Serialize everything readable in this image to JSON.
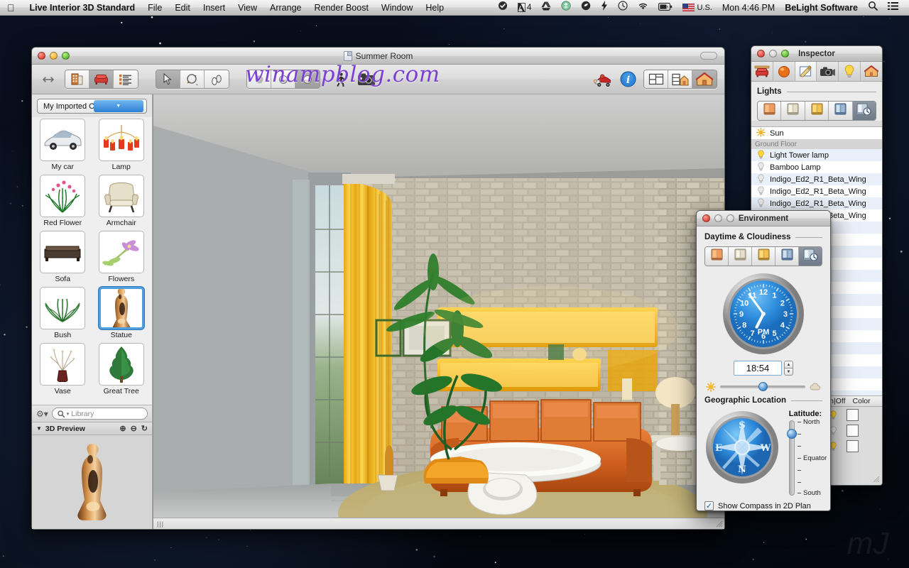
{
  "menubar": {
    "apple_icon": "apple-icon",
    "app_name": "Live Interior 3D Standard",
    "items": [
      "File",
      "Edit",
      "Insert",
      "View",
      "Arrange",
      "Render Boost",
      "Window",
      "Help"
    ],
    "status_icons": [
      "checkmark-circle-icon",
      "adobe-icon",
      "google-drive-icon",
      "dropbox-icon",
      "evernote-icon",
      "flash-icon",
      "time-machine-icon",
      "wifi-icon",
      "battery-icon"
    ],
    "adobe_badge": "4",
    "input_source": "U.S.",
    "clock": "Mon 4:46 PM",
    "user": "BeLight Software",
    "spotlight_icon": "search-icon",
    "notification_icon": "notification-center-icon"
  },
  "main_window": {
    "title": "Summer Room",
    "watermark": "winampblog.com",
    "toolbar": {
      "resize_icon": "resize-arrows-icon",
      "group_view": [
        {
          "name": "elevation-view-button",
          "icon": "building-icon",
          "active": false
        },
        {
          "name": "furniture-view-button",
          "icon": "armchair-icon",
          "active": true
        },
        {
          "name": "list-view-button",
          "icon": "list-icon",
          "active": false
        }
      ],
      "group_tools": [
        {
          "name": "select-tool-button",
          "icon": "arrow-cursor-icon",
          "active": true
        },
        {
          "name": "rotate-tool-button",
          "icon": "rotate-icon",
          "active": false
        },
        {
          "name": "move-tool-button",
          "icon": "footsteps-icon",
          "active": false
        }
      ],
      "group_render": [
        {
          "name": "flat-shading-button",
          "icon": "flat-sphere-icon",
          "active": false
        },
        {
          "name": "smooth-shading-button",
          "icon": "half-sphere-icon",
          "active": false
        },
        {
          "name": "realistic-shading-button",
          "icon": "shaded-sphere-icon",
          "active": true
        }
      ],
      "walk_button": {
        "name": "walkthrough-button",
        "icon": "walking-person-icon"
      },
      "camera_button": {
        "name": "camera-button",
        "icon": "camera-icon"
      },
      "truck_button": {
        "name": "render-boost-button",
        "icon": "red-truck-icon"
      },
      "info_button": {
        "name": "info-button",
        "icon": "info-circle-icon"
      },
      "group_layout": [
        {
          "name": "plan-view-button",
          "icon": "floorplan-icon",
          "active": false
        },
        {
          "name": "split-view-button",
          "icon": "split-house-icon",
          "active": false
        },
        {
          "name": "house-3d-view-button",
          "icon": "house-icon",
          "active": true
        }
      ]
    },
    "library": {
      "category": "My Imported Objects",
      "dropdown_icon": "chevron-down-icon",
      "objects": [
        {
          "label": "My car",
          "icon": "car-thumb",
          "selected": false
        },
        {
          "label": "Lamp",
          "icon": "chandelier-thumb",
          "selected": false
        },
        {
          "label": "Red Flower",
          "icon": "red-flower-thumb",
          "selected": false
        },
        {
          "label": "Armchair",
          "icon": "armchair-thumb",
          "selected": false
        },
        {
          "label": "Sofa",
          "icon": "sofa-thumb",
          "selected": false
        },
        {
          "label": "Flowers",
          "icon": "flowers-thumb",
          "selected": false
        },
        {
          "label": "Bush",
          "icon": "bush-thumb",
          "selected": false
        },
        {
          "label": "Statue",
          "icon": "statue-thumb",
          "selected": true
        },
        {
          "label": "Vase",
          "icon": "vase-thumb",
          "selected": false
        },
        {
          "label": "Great Tree",
          "icon": "tree-thumb",
          "selected": false
        }
      ],
      "gear_icon": "gear-icon",
      "search_icon": "search-icon",
      "search_placeholder": "Library",
      "search_value": "",
      "preview_title": "3D Preview",
      "preview_disclosure_icon": "triangle-down-icon",
      "preview_zoom_in_icon": "zoom-in-icon",
      "preview_zoom_out_icon": "zoom-out-icon",
      "preview_rotate_icon": "rotate-icon"
    },
    "viewport_grip_icon": "resize-grip-icon"
  },
  "inspector": {
    "title": "Inspector",
    "tabs": [
      {
        "name": "object-tab",
        "icon": "furniture-icon",
        "active": false
      },
      {
        "name": "material-tab",
        "icon": "orange-sphere-icon",
        "active": false
      },
      {
        "name": "edit-tab",
        "icon": "pencil-pad-icon",
        "active": true
      },
      {
        "name": "camera-tab",
        "icon": "camera-icon",
        "active": false
      },
      {
        "name": "light-tab",
        "icon": "lightbulb-icon",
        "active": false
      },
      {
        "name": "site-tab",
        "icon": "house-icon",
        "active": false
      }
    ],
    "group_title": "Lights",
    "light_modes": [
      {
        "name": "light-mode-sunset",
        "icon": "window-sunset-icon",
        "active": false
      },
      {
        "name": "light-mode-day",
        "icon": "window-day-icon",
        "active": false
      },
      {
        "name": "light-mode-warm",
        "icon": "window-warm-icon",
        "active": false
      },
      {
        "name": "light-mode-night",
        "icon": "window-night-icon",
        "active": false
      },
      {
        "name": "light-mode-auto",
        "icon": "window-clock-icon",
        "active": true
      }
    ],
    "lights": [
      {
        "label": "Sun",
        "icon": "sun-icon",
        "type": "item"
      },
      {
        "label": "Ground Floor",
        "icon": "",
        "type": "group"
      },
      {
        "label": "Light Tower lamp",
        "icon": "bulb-on-icon",
        "type": "item"
      },
      {
        "label": "Bamboo Lamp",
        "icon": "bulb-off-icon",
        "type": "item"
      },
      {
        "label": "Indigo_Ed2_R1_Beta_Wing",
        "icon": "bulb-off-icon",
        "type": "item"
      },
      {
        "label": "Indigo_Ed2_R1_Beta_Wing",
        "icon": "bulb-off-icon",
        "type": "item"
      },
      {
        "label": "Indigo_Ed2_R1_Beta_Wing",
        "icon": "bulb-off-icon",
        "type": "item"
      },
      {
        "label": "Indigo_Ed2_R1_Beta_Wing",
        "icon": "bulb-off-icon",
        "type": "item"
      }
    ],
    "columns": [
      "On|Off",
      "Color"
    ],
    "column_rows": [
      {
        "bulb": "bulb-on-icon",
        "color": "#ffffff"
      },
      {
        "bulb": "bulb-off-icon",
        "color": "#ffffff"
      },
      {
        "bulb": "bulb-on-icon",
        "color": "#ffffff"
      }
    ],
    "resize_grip_icon": "resize-grip-icon"
  },
  "environment": {
    "title": "Environment",
    "daytime_title": "Daytime & Cloudiness",
    "daytime_modes": [
      {
        "name": "daytime-sunset",
        "icon": "window-sunset-icon",
        "active": false
      },
      {
        "name": "daytime-day",
        "icon": "window-day-icon",
        "active": false
      },
      {
        "name": "daytime-warm",
        "icon": "window-warm-icon",
        "active": false
      },
      {
        "name": "daytime-night",
        "icon": "window-night-icon",
        "active": false
      },
      {
        "name": "daytime-auto",
        "icon": "window-clock-icon",
        "active": true
      }
    ],
    "clock": {
      "name": "analog-clock",
      "numbers": [
        "12",
        "1",
        "2",
        "3",
        "4",
        "5",
        "6",
        "7",
        "8",
        "9",
        "10",
        "11"
      ],
      "meridiem": "PM",
      "hour_angle": 207,
      "minute_angle": 324
    },
    "time_value": "18:54",
    "stepper_up_icon": "triangle-up-icon",
    "stepper_down_icon": "triangle-down-icon",
    "cloud_slider": {
      "left_icon": "sun-icon",
      "right_icon": "cloud-icon",
      "value_pct": 50
    },
    "geo_title": "Geographic Location",
    "compass_icon": "compass-rose",
    "latitude_label": "Latitude:",
    "latitude_ticks": [
      "North",
      "",
      "",
      "Equator",
      "",
      "",
      "South"
    ],
    "latitude_value_pct": 18,
    "checkbox_label": "Show Compass in 2D Plan",
    "checkbox_checked": true,
    "check_icon": "checkmark-icon"
  },
  "colors": {
    "accent_blue": "#2b7fd4",
    "selection_blue": "#4f9ede",
    "watermark_purple": "#7b3fd4",
    "desktop_dark": "#060b16"
  }
}
